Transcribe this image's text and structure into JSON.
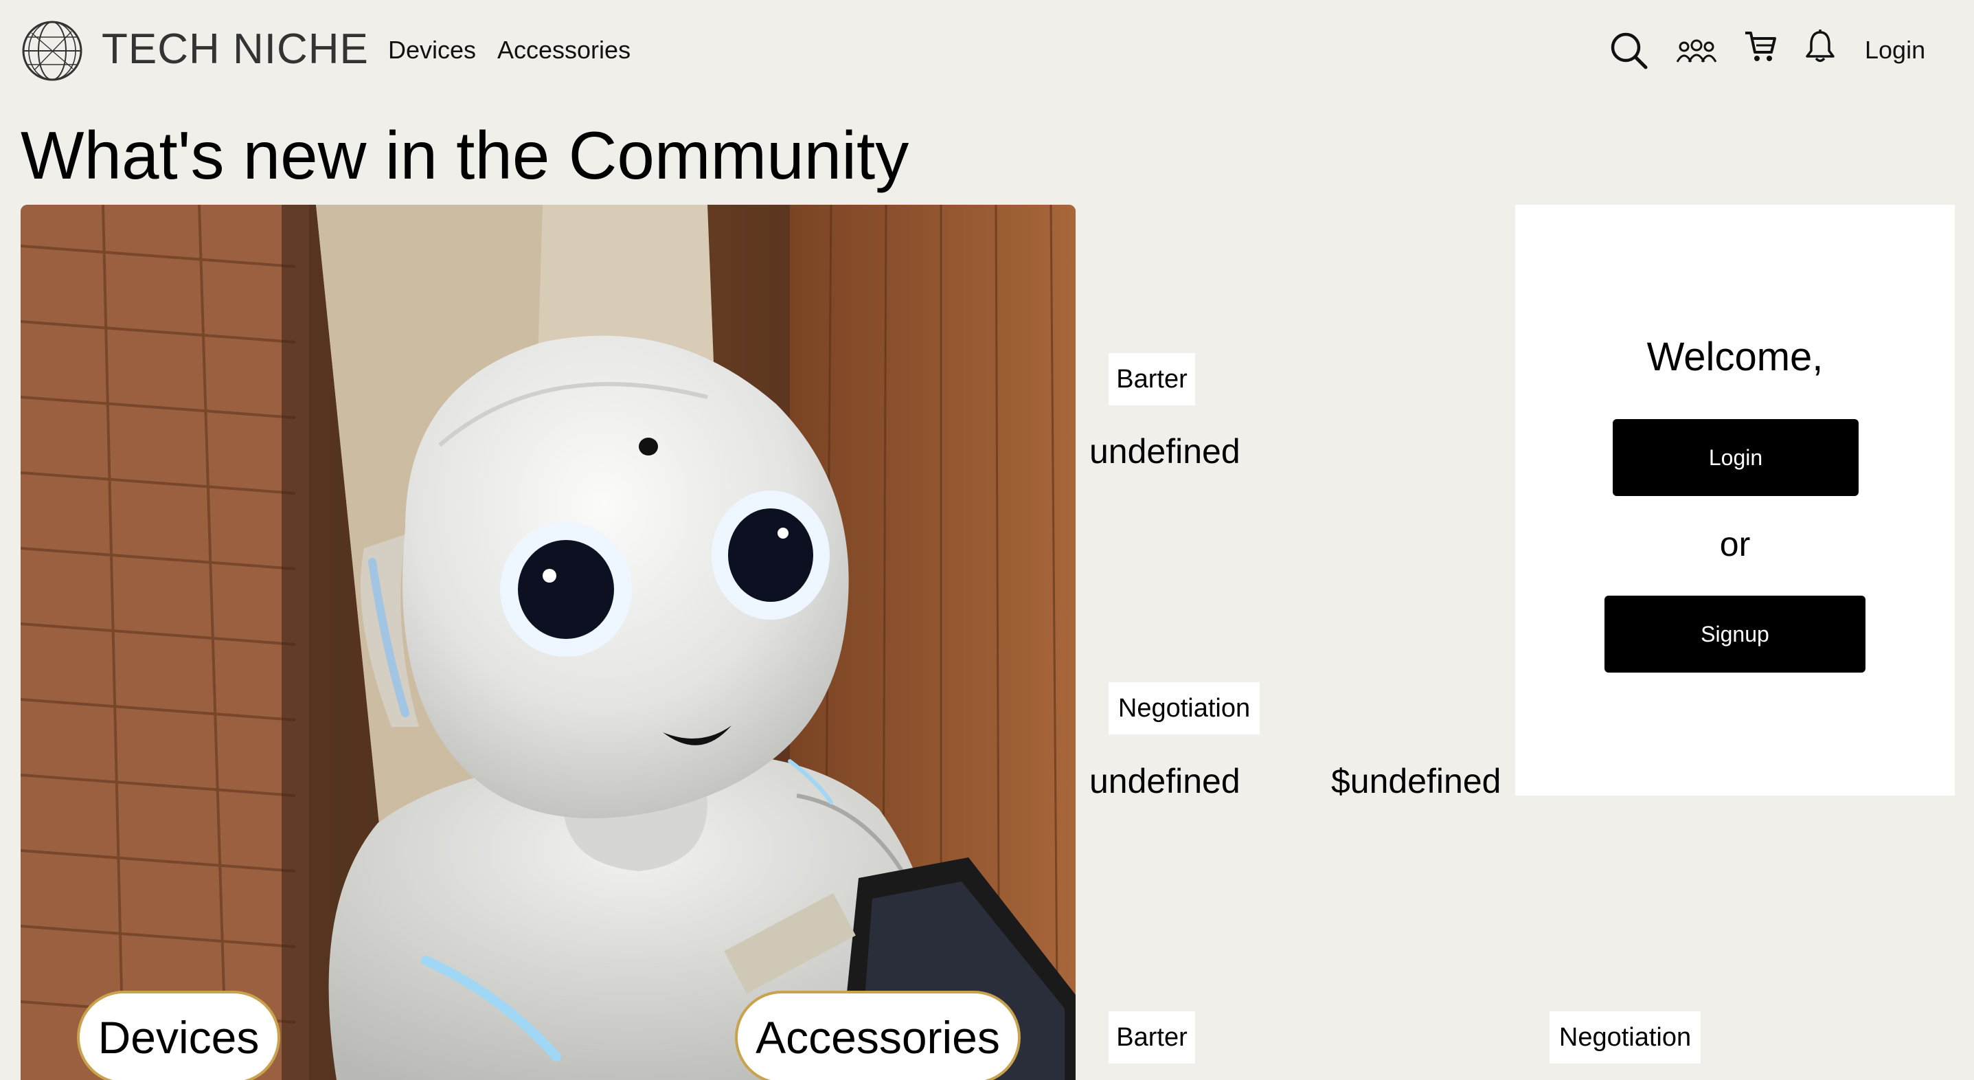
{
  "header": {
    "brand": "TECH NICHE",
    "nav": [
      "Devices",
      "Accessories"
    ],
    "login_label": "Login",
    "icons": [
      "globe-logo-icon",
      "search-icon",
      "community-icon",
      "cart-icon",
      "bell-icon"
    ]
  },
  "page_title": "What's new in the Community",
  "hero": {
    "image": "white humanoid robot photo",
    "pills": [
      "Devices",
      "Accessories"
    ],
    "pill_border_color": "#c9a24e"
  },
  "listings": [
    {
      "tag": "Barter",
      "name": "undefined"
    },
    {
      "tag": "Negotiation",
      "name": "undefined",
      "price": "$undefined"
    },
    {
      "tag": "Barter"
    },
    {
      "tag": "Negotiation"
    }
  ],
  "welcome": {
    "title": "Welcome,",
    "login_label": "Login",
    "or_label": "or",
    "signup_label": "Signup"
  },
  "colors": {
    "background": "#f1efea",
    "card": "#ffffff",
    "button": "#000000"
  }
}
